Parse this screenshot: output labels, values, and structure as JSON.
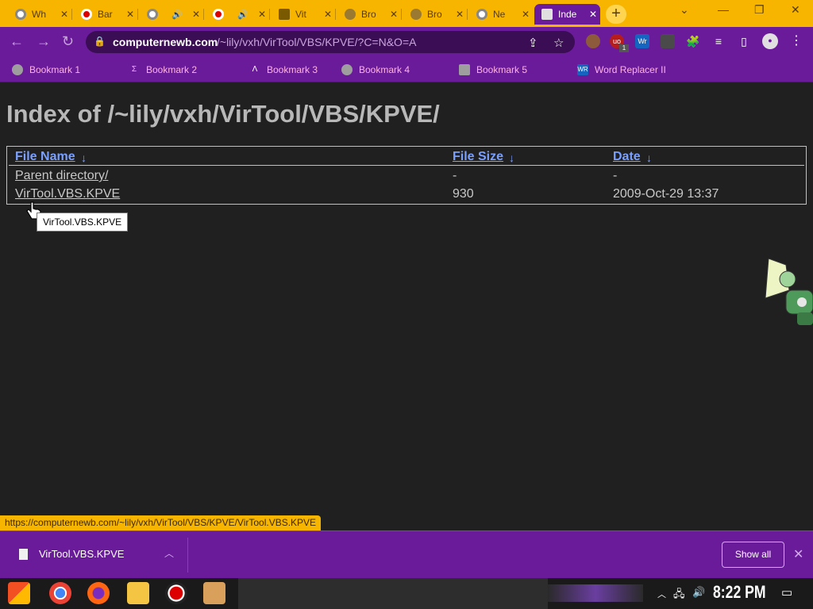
{
  "browser": {
    "tabs": [
      {
        "title": "Wh",
        "icon": "chrome-icon"
      },
      {
        "title": "Bar",
        "icon": "record-icon"
      },
      {
        "title": "",
        "icon": "chrome-icon",
        "audio": true
      },
      {
        "title": "",
        "icon": "record-icon",
        "audio": true
      },
      {
        "title": "Vit",
        "icon": "video-icon"
      },
      {
        "title": "Bro",
        "icon": "ufo-icon"
      },
      {
        "title": "Bro",
        "icon": "ufo-icon"
      },
      {
        "title": "Ne",
        "icon": "chrome-icon"
      },
      {
        "title": "Inde",
        "icon": "cube-icon",
        "active": true
      }
    ],
    "url_host": "computernewb.com",
    "url_path": "/~lily/vxh/VirTool/VBS/KPVE/?C=N&O=A",
    "bookmarks": [
      {
        "label": "Bookmark 1"
      },
      {
        "label": "Bookmark 2"
      },
      {
        "label": "Bookmark 3"
      },
      {
        "label": "Bookmark 4"
      },
      {
        "label": "Bookmark 5"
      },
      {
        "label": "Word Replacer II"
      }
    ],
    "extension_badge": "1"
  },
  "page": {
    "title": "Index of /~lily/vxh/VirTool/VBS/KPVE/",
    "columns": [
      "File Name",
      "File Size",
      "Date"
    ],
    "sort_indicator": "↓",
    "rows": [
      {
        "name": "Parent directory/",
        "size": "-",
        "date": "-"
      },
      {
        "name": "VirTool.VBS.KPVE",
        "size": "930",
        "date": "2009-Oct-29 13:37"
      }
    ],
    "tooltip": "VirTool.VBS.KPVE",
    "status_url": "https://computernewb.com/~lily/vxh/VirTool/VBS/KPVE/VirTool.VBS.KPVE"
  },
  "downloads": {
    "file_name": "VirTool.VBS.KPVE",
    "show_all_label": "Show all"
  },
  "taskbar": {
    "time": "8:22 PM"
  },
  "colors": {
    "tabstrip": "#f7b500",
    "toolbar": "#6a1b9a",
    "link_visited": "#a489d6",
    "link_hover": "#ff3b30",
    "header_link": "#7aa0ff"
  }
}
